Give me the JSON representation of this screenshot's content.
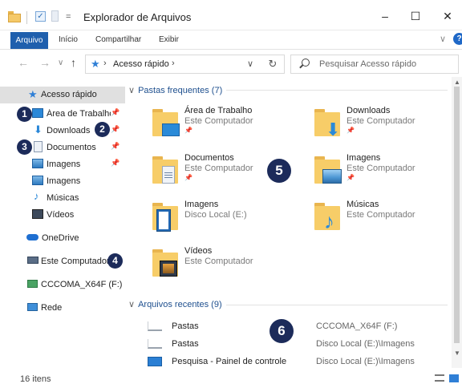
{
  "window": {
    "title": "Explorador de Arquivos",
    "min": "–",
    "max": "☐",
    "close": "✕"
  },
  "ribbon": {
    "file": "Arquivo",
    "tabs": [
      "Início",
      "Compartilhar",
      "Exibir"
    ]
  },
  "nav": {
    "address": "Acesso rápido",
    "search_placeholder": "Pesquisar Acesso rápido"
  },
  "sidebar": {
    "quick_access": "Acesso rápido",
    "items": [
      {
        "label": "Área de Trabalho",
        "icon": "desktop-icon",
        "pinned": true
      },
      {
        "label": "Downloads",
        "icon": "download-icon",
        "pinned": true
      },
      {
        "label": "Documentos",
        "icon": "document-icon",
        "pinned": true
      },
      {
        "label": "Imagens",
        "icon": "pictures-icon",
        "pinned": true
      },
      {
        "label": "Imagens",
        "icon": "pictures-icon",
        "pinned": false
      },
      {
        "label": "Músicas",
        "icon": "music-icon",
        "pinned": false
      },
      {
        "label": "Vídeos",
        "icon": "video-icon",
        "pinned": false
      }
    ],
    "onedrive": "OneDrive",
    "this_pc": "Este Computador",
    "drive": "CCCOMA_X64F (F:)",
    "network": "Rede"
  },
  "markers": [
    "1",
    "2",
    "3",
    "4",
    "5",
    "6"
  ],
  "frequent": {
    "header": "Pastas frequentes (7)",
    "tiles": [
      {
        "name": "Área de Trabalho",
        "location": "Este Computador",
        "pinned": true
      },
      {
        "name": "Downloads",
        "location": "Este Computador",
        "pinned": true
      },
      {
        "name": "Documentos",
        "location": "Este Computador",
        "pinned": true
      },
      {
        "name": "Imagens",
        "location": "Este Computador",
        "pinned": true
      },
      {
        "name": "Imagens",
        "location": "Disco Local (E:)",
        "pinned": false
      },
      {
        "name": "Músicas",
        "location": "Este Computador",
        "pinned": false
      },
      {
        "name": "Vídeos",
        "location": "Este Computador",
        "pinned": false
      }
    ]
  },
  "recent": {
    "header": "Arquivos recentes (9)",
    "rows": [
      {
        "name": "Pastas",
        "path": "CCCOMA_X64F (F:)"
      },
      {
        "name": "Pastas",
        "path": "Disco Local (E:)\\Imagens"
      },
      {
        "name": "Pesquisa - Painel de controle",
        "path": "Disco Local (E:)\\Imagens"
      }
    ]
  },
  "status": {
    "count": "16 itens"
  },
  "colors": {
    "accent": "#1f5fad",
    "marker": "#1c2b5a",
    "folder": "#f7cd68"
  }
}
